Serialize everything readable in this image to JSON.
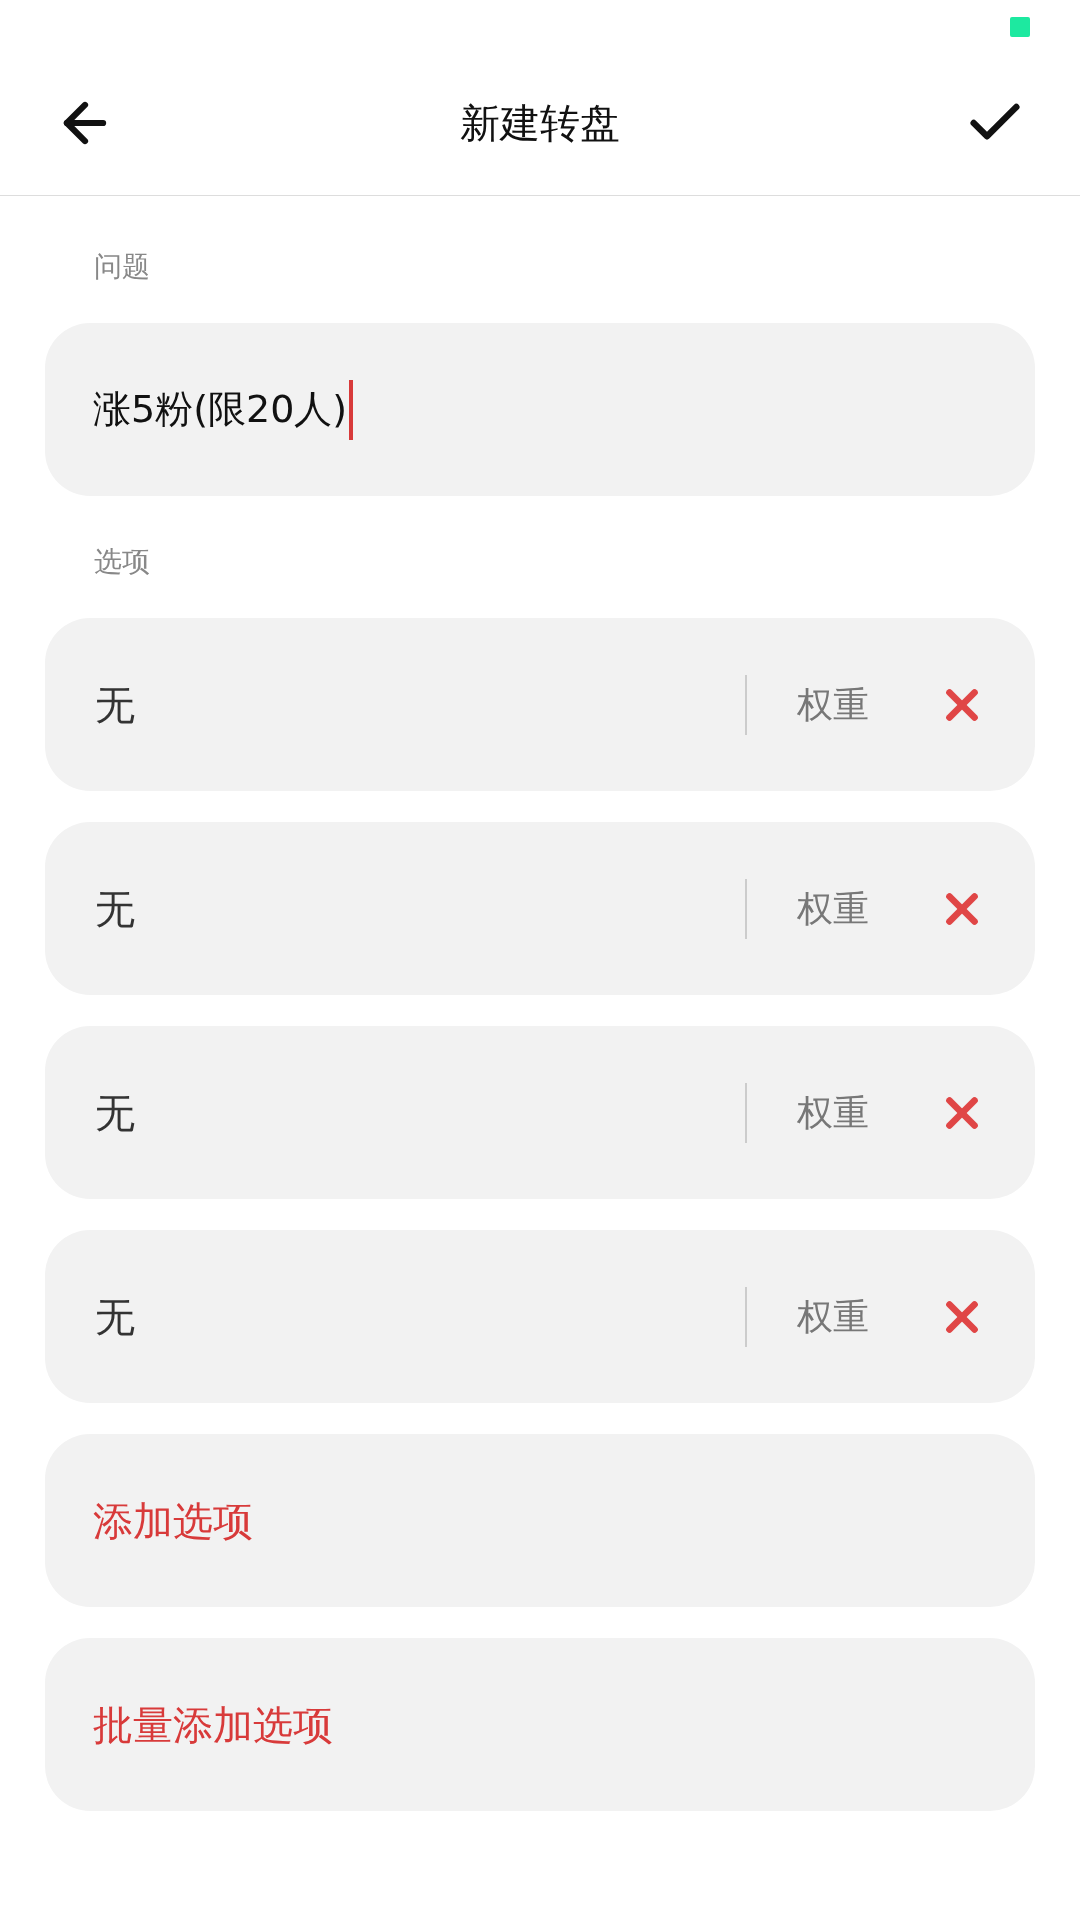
{
  "header": {
    "title": "新建转盘"
  },
  "question": {
    "label": "问题",
    "value": "涨5粉(限20人)"
  },
  "options": {
    "label": "选项",
    "items": [
      {
        "value": "无",
        "weight_placeholder": "权重"
      },
      {
        "value": "无",
        "weight_placeholder": "权重"
      },
      {
        "value": "无",
        "weight_placeholder": "权重"
      },
      {
        "value": "无",
        "weight_placeholder": "权重"
      }
    ]
  },
  "actions": [
    "添加选项",
    "批量添加选项"
  ]
}
